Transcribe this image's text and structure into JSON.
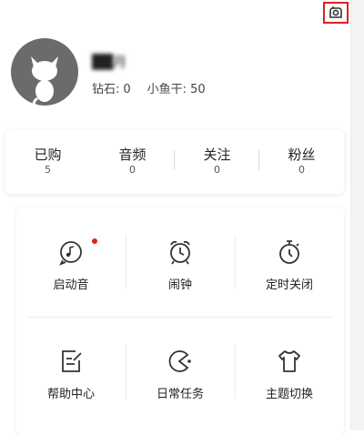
{
  "profile": {
    "nickname": "██月",
    "diamond_label": "钻石:",
    "diamond_value": "0",
    "fish_label": "小鱼干:",
    "fish_value": "50"
  },
  "counts": [
    {
      "label": "已购",
      "value": "5"
    },
    {
      "label": "音频",
      "value": "0"
    },
    {
      "label": "关注",
      "value": "0"
    },
    {
      "label": "粉丝",
      "value": "0"
    }
  ],
  "menu": [
    {
      "label": "启动音",
      "icon": "startup-sound-icon",
      "badge": true
    },
    {
      "label": "闹钟",
      "icon": "alarm-clock-icon"
    },
    {
      "label": "定时关闭",
      "icon": "timer-icon"
    },
    {
      "label": "帮助中心",
      "icon": "help-center-icon"
    },
    {
      "label": "日常任务",
      "icon": "daily-task-icon"
    },
    {
      "label": "主题切换",
      "icon": "theme-switch-icon"
    }
  ],
  "colors": {
    "accent": "#e0201e",
    "avatar_bg": "#6b6b6b"
  }
}
